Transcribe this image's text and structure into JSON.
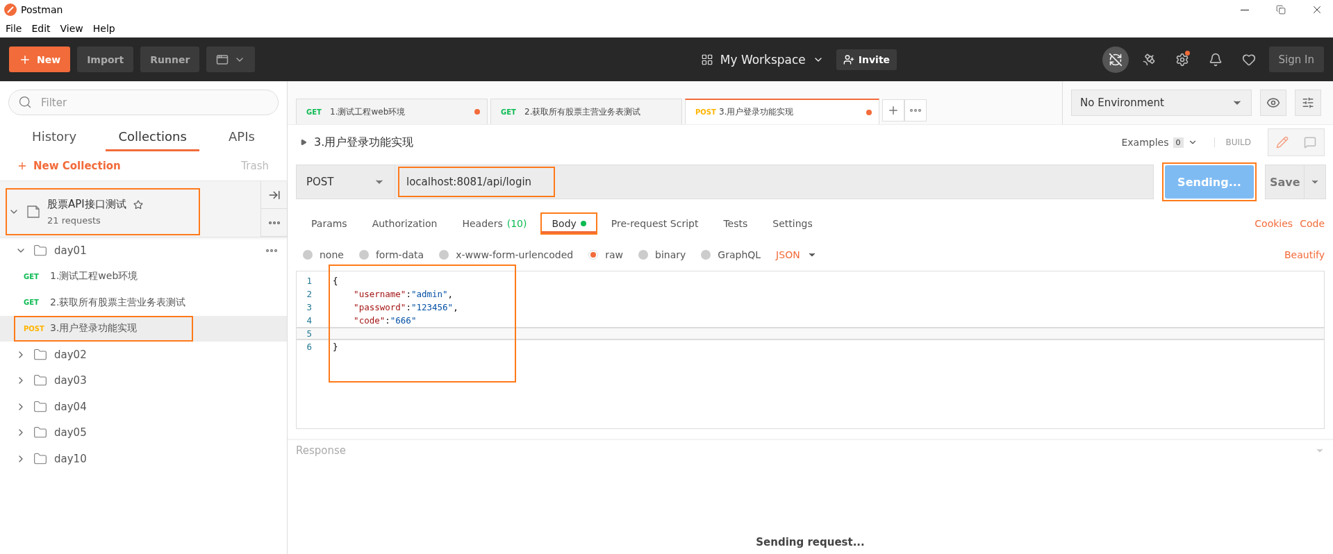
{
  "window": {
    "title": "Postman"
  },
  "menu": [
    "File",
    "Edit",
    "View",
    "Help"
  ],
  "toolbar": {
    "new": "New",
    "import": "Import",
    "runner": "Runner",
    "workspace": "My Workspace",
    "invite": "Invite",
    "sign_in": "Sign In",
    "settings_badge": true
  },
  "sidebar": {
    "filter_placeholder": "Filter",
    "tabs": [
      {
        "label": "History",
        "selected": false
      },
      {
        "label": "Collections",
        "selected": true
      },
      {
        "label": "APIs",
        "selected": false
      }
    ],
    "new_collection": "New Collection",
    "trash": "Trash",
    "collection": {
      "name": "股票API接口测试",
      "count": "21 requests",
      "expanded": true,
      "annotated": true,
      "children": [
        {
          "kind": "folder",
          "name": "day01",
          "expanded": true,
          "children": [
            {
              "kind": "request",
              "method": "GET",
              "color": "#0cbb52",
              "name": "1.测试工程web环境",
              "selected": false,
              "annotated": false
            },
            {
              "kind": "request",
              "method": "GET",
              "color": "#0cbb52",
              "name": "2.获取所有股票主营业务表测试",
              "selected": false,
              "annotated": false
            },
            {
              "kind": "request",
              "method": "POST",
              "color": "#ffb400",
              "name": "3.用户登录功能实现",
              "selected": true,
              "annotated": true
            }
          ]
        },
        {
          "kind": "folder",
          "name": "day02",
          "expanded": false
        },
        {
          "kind": "folder",
          "name": "day03",
          "expanded": false
        },
        {
          "kind": "folder",
          "name": "day04",
          "expanded": false
        },
        {
          "kind": "folder",
          "name": "day05",
          "expanded": false
        },
        {
          "kind": "folder",
          "name": "day10",
          "expanded": false
        }
      ]
    }
  },
  "request_tabs": [
    {
      "method": "GET",
      "color": "#0cbb52",
      "name": "1.测试工程web环境",
      "unsaved": true,
      "selected": false
    },
    {
      "method": "GET",
      "color": "#0cbb52",
      "name": "2.获取所有股票主营业务表测试",
      "unsaved": false,
      "selected": false
    },
    {
      "method": "POST",
      "color": "#ffb400",
      "name": "3.用户登录功能实现",
      "unsaved": true,
      "selected": true
    }
  ],
  "environment": "No Environment",
  "request": {
    "name": "3.用户登录功能实现",
    "examples": "Examples",
    "examples_count": "0",
    "build": "BUILD",
    "method": "POST",
    "url": "localhost:8081/api/login",
    "url_annotated": true,
    "send": "Sending...",
    "send_annotated": true,
    "save": "Save"
  },
  "option_tabs": [
    {
      "label": "Params",
      "selected": false,
      "annotated": false,
      "indicator": false
    },
    {
      "label": "Authorization",
      "selected": false,
      "annotated": false,
      "indicator": false
    },
    {
      "label": "Headers",
      "count": "(10)",
      "selected": false,
      "annotated": false,
      "indicator": false
    },
    {
      "label": "Body",
      "selected": true,
      "annotated": true,
      "indicator": true
    },
    {
      "label": "Pre-request Script",
      "selected": false,
      "annotated": false,
      "indicator": false
    },
    {
      "label": "Tests",
      "selected": false,
      "annotated": false,
      "indicator": false
    },
    {
      "label": "Settings",
      "selected": false,
      "annotated": false,
      "indicator": false
    }
  ],
  "option_links": [
    "Cookies",
    "Code"
  ],
  "body_modes": [
    {
      "label": "none",
      "selected": false
    },
    {
      "label": "form-data",
      "selected": false
    },
    {
      "label": "x-www-form-urlencoded",
      "selected": false
    },
    {
      "label": "raw",
      "selected": true
    },
    {
      "label": "binary",
      "selected": false
    },
    {
      "label": "GraphQL",
      "selected": false
    }
  ],
  "body_format": "JSON",
  "beautify": "Beautify",
  "editor": {
    "annotated": true,
    "lines": [
      {
        "no": "1",
        "text": "{",
        "current": false
      },
      {
        "no": "2",
        "text": "    \"username\":\"admin\",",
        "current": false
      },
      {
        "no": "3",
        "text": "    \"password\":\"123456\",",
        "current": false
      },
      {
        "no": "4",
        "text": "    \"code\":\"666\"",
        "current": false
      },
      {
        "no": "5",
        "current": true
      },
      {
        "no": "6",
        "text": "}",
        "current": false
      }
    ]
  },
  "response": {
    "title": "Response",
    "status": "Sending request..."
  }
}
